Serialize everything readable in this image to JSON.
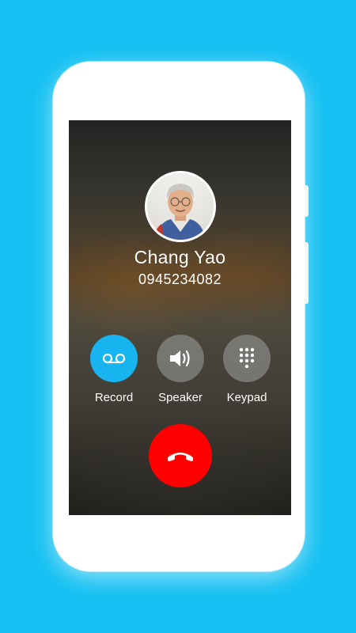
{
  "caller": {
    "name": "Chang Yao",
    "number": "0945234082",
    "avatar_icon": "caller-photo"
  },
  "actions": {
    "record": {
      "label": "Record",
      "icon": "voicemail-icon",
      "color": "#17b4ef"
    },
    "speaker": {
      "label": "Speaker",
      "icon": "speaker-icon"
    },
    "keypad": {
      "label": "Keypad",
      "icon": "keypad-icon"
    }
  },
  "end_call": {
    "icon": "phone-hangup-icon",
    "color": "#ff0000"
  },
  "theme": {
    "background": "#14c0f2",
    "device": "#ffffff"
  }
}
